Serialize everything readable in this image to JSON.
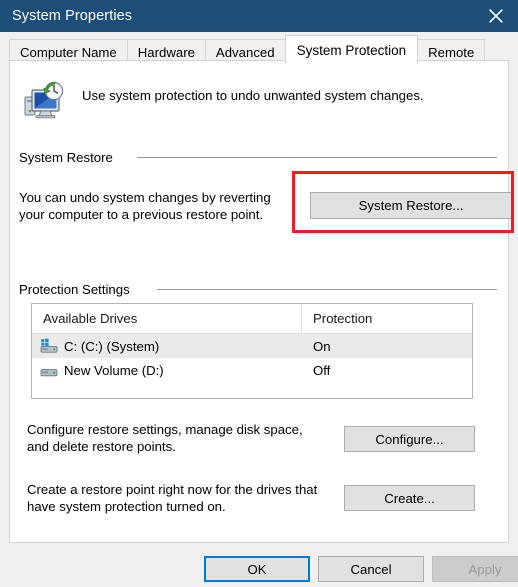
{
  "window": {
    "title": "System Properties",
    "close_icon": "close-icon"
  },
  "tabs": [
    {
      "label": "Computer Name",
      "active": false
    },
    {
      "label": "Hardware",
      "active": false
    },
    {
      "label": "Advanced",
      "active": false
    },
    {
      "label": "System Protection",
      "active": true
    },
    {
      "label": "Remote",
      "active": false
    }
  ],
  "header": {
    "icon": "system-restore-icon",
    "text": "Use system protection to undo unwanted system changes."
  },
  "system_restore": {
    "group_label": "System Restore",
    "description": "You can undo system changes by reverting\nyour computer to a previous restore point.",
    "button_label": "System Restore...",
    "highlight_color": "#ee1d23"
  },
  "protection_settings": {
    "group_label": "Protection Settings",
    "columns": [
      "Available Drives",
      "Protection"
    ],
    "rows": [
      {
        "icon": "system-drive-icon",
        "drive": "C: (C:) (System)",
        "protection": "On",
        "selected": true
      },
      {
        "icon": "drive-icon",
        "drive": "New Volume (D:)",
        "protection": "Off",
        "selected": false
      }
    ]
  },
  "configure_section": {
    "description": "Configure restore settings, manage disk space,\nand delete restore points.",
    "button_label": "Configure..."
  },
  "create_section": {
    "description": "Create a restore point right now for the drives that\nhave system protection turned on.",
    "button_label": "Create..."
  },
  "footer": {
    "ok_label": "OK",
    "cancel_label": "Cancel",
    "apply_label": "Apply",
    "apply_disabled": true,
    "focus_color": "#0078d7"
  }
}
